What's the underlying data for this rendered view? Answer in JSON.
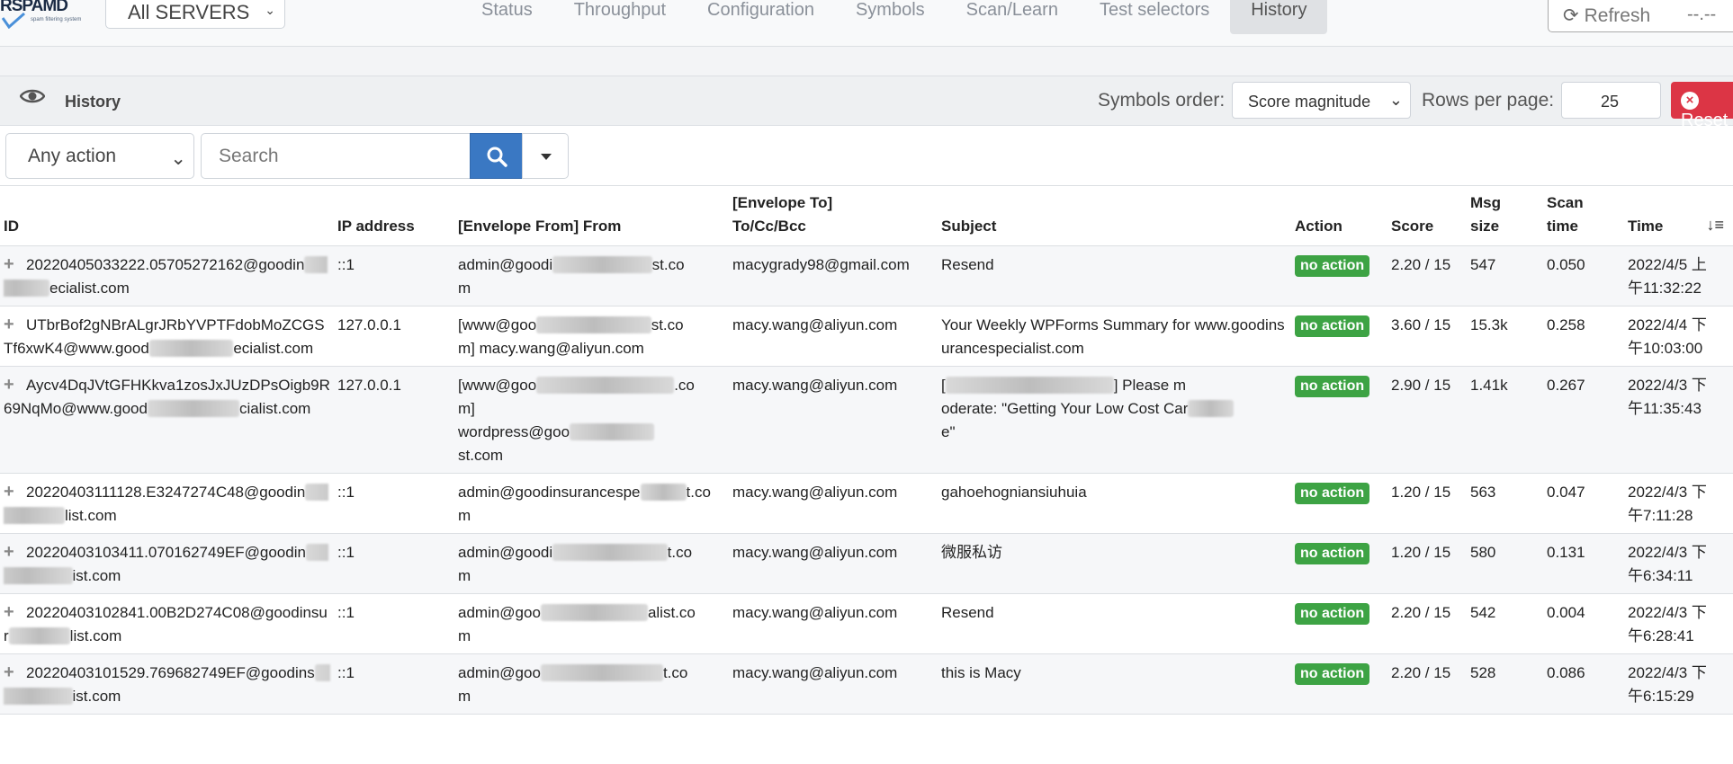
{
  "brand": {
    "logo_text": "RSPAMD",
    "logo_tagline": "spam filtering system"
  },
  "navbar": {
    "server_select": "All SERVERS",
    "tabs": [
      {
        "label": "Status"
      },
      {
        "label": "Throughput"
      },
      {
        "label": "Configuration"
      },
      {
        "label": "Symbols"
      },
      {
        "label": "Scan/Learn"
      },
      {
        "label": "Test selectors"
      },
      {
        "label": "History"
      }
    ],
    "active_tab": "History",
    "refresh_label": "Refresh",
    "refresh_interval": "--.--"
  },
  "history": {
    "title": "History",
    "symbols_order_label": "Symbols order:",
    "symbols_order_value": "Score magnitude",
    "rows_per_page_label": "Rows per page:",
    "rows_per_page_value": "25",
    "reset_label": "Reset",
    "action_filter": "Any action",
    "search_placeholder": "Search",
    "columns": {
      "id": "ID",
      "ip": "IP address",
      "from": "[Envelope From] From",
      "to_line1": "[Envelope To]",
      "to_line2": "To/Cc/Bcc",
      "subject": "Subject",
      "action": "Action",
      "score": "Score",
      "size_line1": "Msg",
      "size_line2": "size",
      "scan_line1": "Scan",
      "scan_line2": "time",
      "time": "Time"
    },
    "rows": [
      {
        "id_a": "20220405033222.05705272162@goodi",
        "id_b": "n",
        "id_c": "ecialist.com",
        "ip": "::1",
        "from_a": "admin@goodi",
        "from_b": "st.co",
        "from_c": "m",
        "to": "macygrady98@gmail.com",
        "subject": "Resend",
        "action": "no action",
        "score": "2.20 / 15",
        "size": "547",
        "scan": "0.050",
        "time_a": "2022/4/5 上",
        "time_b": "午11:32:22"
      },
      {
        "id_a": "UTbrBof2gNBrALgrJRbYVPTFdobMoZ",
        "id_b": "CGSTf6xwK4@www.good",
        "id_c": "eciali",
        "id_d": "st.com",
        "ip": "127.0.0.1",
        "from_a": "[www@goo",
        "from_b": "st.co",
        "from_c": "m] macy.wang@aliyun.com",
        "to": "macy.wang@aliyun.com",
        "subject": "Your Weekly WPForms Summary for www.goodinsurancespecialist.com",
        "action": "no action",
        "score": "3.60 / 15",
        "size": "15.3k",
        "scan": "0.258",
        "time_a": "2022/4/4 下",
        "time_b": "午10:03:00"
      },
      {
        "id_a": "Aycv4DqJVtGFHKkva1zosJxJUzDPsOi",
        "id_b": "gb9R69NqMo@www.good",
        "id_c": "ciali",
        "id_d": "st.com",
        "ip": "127.0.0.1",
        "from_a": "[www@goo",
        "from_b": ".co",
        "from_c": "m]",
        "from_d": "wordpress@goo",
        "from_e": "st.com",
        "to": "macy.wang@aliyun.com",
        "subject_a": "[",
        "subject_b": "] Please m",
        "subject_c": "oderate: \"Getting Your Low Cost Car",
        "subject_d": "e\"",
        "action": "no action",
        "score": "2.90 / 15",
        "size": "1.41k",
        "scan": "0.267",
        "time_a": "2022/4/3 下",
        "time_b": "午11:35:43"
      },
      {
        "id_a": "20220403111128.E3247274C48@goodi",
        "id_b": "n",
        "id_c": "list.com",
        "ip": "::1",
        "from_a": "admin@goodinsurancespe",
        "from_b": "t.co",
        "from_c": "m",
        "to": "macy.wang@aliyun.com",
        "subject": "gahoehogniansiuhuia",
        "action": "no action",
        "score": "1.20 / 15",
        "size": "563",
        "scan": "0.047",
        "time_a": "2022/4/3 下",
        "time_b": "午7:11:28"
      },
      {
        "id_a": "20220403103411.070162749EF@goodi",
        "id_b": "n",
        "id_c": "ist.com",
        "ip": "::1",
        "from_a": "admin@goodi",
        "from_b": "t.co",
        "from_c": "m",
        "to": "macy.wang@aliyun.com",
        "subject": "微服私访",
        "action": "no action",
        "score": "1.20 / 15",
        "size": "580",
        "scan": "0.131",
        "time_a": "2022/4/3 下",
        "time_b": "午6:34:11"
      },
      {
        "id_a": "20220403102841.00B2D274C08@good",
        "id_b": "insur",
        "id_c": "list.com",
        "ip": "::1",
        "from_a": "admin@goo",
        "from_b": "alist.co",
        "from_c": "m",
        "to": "macy.wang@aliyun.com",
        "subject": "Resend",
        "action": "no action",
        "score": "2.20 / 15",
        "size": "542",
        "scan": "0.004",
        "time_a": "2022/4/3 下",
        "time_b": "午6:28:41"
      },
      {
        "id_a": "20220403101529.769682749EF@goodi",
        "id_b": "ns",
        "id_c": "ist.com",
        "ip": "::1",
        "from_a": "admin@goo",
        "from_b": "t.co",
        "from_c": "m",
        "to": "macy.wang@aliyun.com",
        "subject": "this is Macy",
        "action": "no action",
        "score": "2.20 / 15",
        "size": "528",
        "scan": "0.086",
        "time_a": "2022/4/3 下",
        "time_b": "午6:15:29"
      }
    ]
  },
  "colors": {
    "accent": "#3a78c3",
    "success": "#3da344",
    "danger": "#dc3545"
  },
  "icons": [
    "eye-icon",
    "search-icon",
    "refresh-icon",
    "expand-plus-icon",
    "sort-icon",
    "close-circle-icon"
  ]
}
